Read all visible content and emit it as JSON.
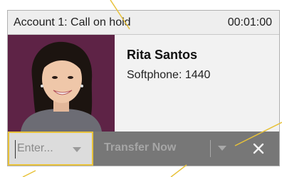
{
  "header": {
    "title": "Account 1: Call on hold",
    "timer": "00:01:00"
  },
  "contact": {
    "name": "Rita Santos",
    "detail": "Softphone: 1440"
  },
  "actions": {
    "entry_placeholder": "Enter...",
    "transfer_label": "Transfer Now",
    "close_symbol": "✕"
  },
  "colors": {
    "photo_background": "#5e2346",
    "action_bar": "#777777",
    "callout_line": "#e8c23a"
  },
  "icons": {
    "entry_dropdown": "chevron-down-icon",
    "transfer_options": "chevron-down-icon",
    "close": "close-icon"
  }
}
